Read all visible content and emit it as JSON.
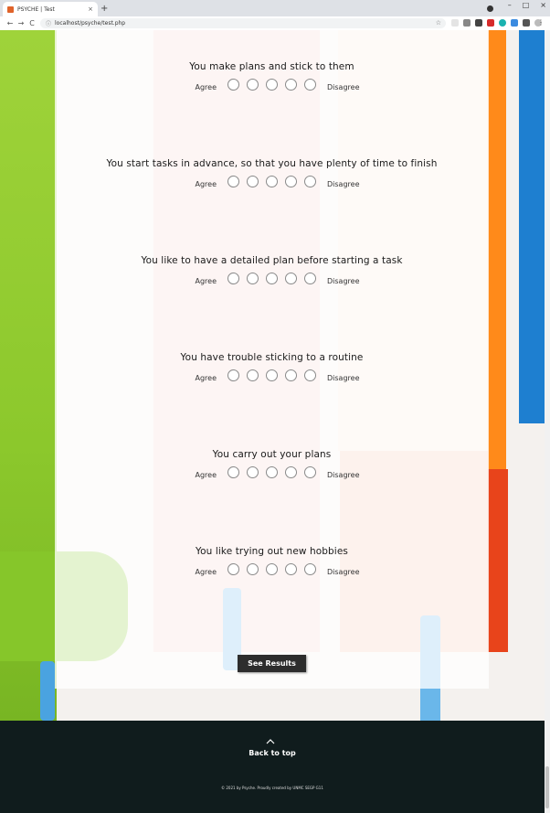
{
  "browser": {
    "tab_title": "PSYCHE | Test",
    "tab_close": "×",
    "new_tab": "+",
    "url": "localhost/psyche/test.php",
    "back": "←",
    "forward": "→",
    "reload": "C",
    "window_minimize": "–",
    "window_maximize": "□",
    "window_close": "×"
  },
  "colors": {
    "footer_bg": "#101c1d",
    "button_bg": "#2d2d2d",
    "accent_green": "#8cc82c",
    "accent_orange": "#ff8a1a",
    "accent_blue": "#1e7fd0"
  },
  "questions": [
    {
      "text": "You make plans and stick to them",
      "left_label": "Agree",
      "right_label": "Disagree"
    },
    {
      "text": "You start tasks in advance, so that you have plenty of time to finish",
      "left_label": "Agree",
      "right_label": "Disagree"
    },
    {
      "text": "You like to have a detailed plan before starting a task",
      "left_label": "Agree",
      "right_label": "Disagree"
    },
    {
      "text": "You have trouble sticking to a routine",
      "left_label": "Agree",
      "right_label": "Disagree"
    },
    {
      "text": "You carry out your plans",
      "left_label": "Agree",
      "right_label": "Disagree"
    },
    {
      "text": "You like trying out new hobbies",
      "left_label": "Agree",
      "right_label": "Disagree"
    }
  ],
  "submit_label": "See Results",
  "footer": {
    "back_to_top": "Back to top",
    "copyright": "© 2021 by Psyche. Proudly created by UNMC SEGP G11"
  }
}
